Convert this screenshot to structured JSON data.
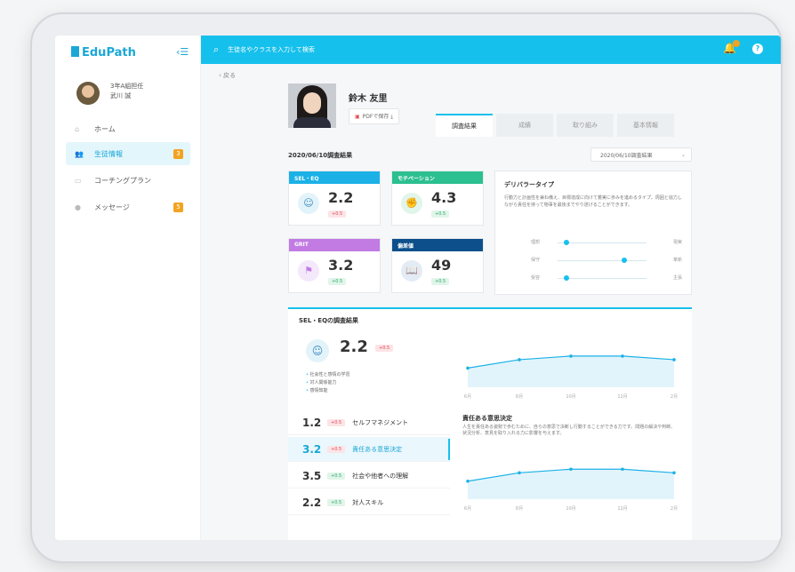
{
  "sidebar": {
    "logo": "EduPath",
    "collapse_icon": "menu-collapse-icon",
    "user": {
      "class": "3年A組担任",
      "name": "武川 誠"
    },
    "items": [
      {
        "label": "ホーム",
        "icon": "home-icon",
        "active": false,
        "badge": ""
      },
      {
        "label": "生徒情報",
        "icon": "users-icon",
        "active": true,
        "badge": "3"
      },
      {
        "label": "コーチングプラン",
        "icon": "plan-icon",
        "active": false,
        "badge": ""
      },
      {
        "label": "メッセージ",
        "icon": "message-icon",
        "active": false,
        "badge": "5"
      }
    ]
  },
  "header": {
    "search_placeholder": "生徒名やクラスを入力して検索",
    "notification_badge": "1",
    "help": "?"
  },
  "main": {
    "back": "‹ 戻る",
    "student_name": "鈴木 友里",
    "pdf_label": "PDFで保存 ⤓",
    "tabs": [
      "調査結果",
      "成績",
      "取り組み",
      "基本情報"
    ],
    "active_tab": 0,
    "result_title": "2020/06/10調査結果",
    "date_select": "2020/06/10調査結果",
    "metrics": [
      {
        "title": "SEL・EQ",
        "value": "2.2",
        "delta": "+0.5",
        "delta_type": "red",
        "color": "#1bb1e6",
        "icon": "sel-icon"
      },
      {
        "title": "モチベーション",
        "value": "4.3",
        "delta": "+0.5",
        "delta_type": "green",
        "color": "#2cbf8f",
        "icon": "motivation-icon"
      },
      {
        "title": "GRIT",
        "value": "3.2",
        "delta": "+0.5",
        "delta_type": "green",
        "color": "#c17be3",
        "icon": "flag-icon"
      },
      {
        "title": "偏差値",
        "value": "49",
        "delta": "+0.5",
        "delta_type": "green",
        "color": "#0d4f8b",
        "icon": "book-icon"
      }
    ],
    "type_card": {
      "title": "デリバラータイプ",
      "desc": "行動力と計画性を兼ね備え、目標達成に向けて着実に歩みを進めるタイプ。周囲と協力しながら責任を持って物事を最後までやり遂げることができます。",
      "sliders": [
        {
          "left": "理想",
          "right": "現実",
          "pos": 0.1
        },
        {
          "left": "保守",
          "right": "革新",
          "pos": 0.75
        },
        {
          "left": "受容",
          "right": "主張",
          "pos": 0.1
        }
      ]
    },
    "sel_panel": {
      "title": "SEL・EQの調査結果",
      "value": "2.2",
      "delta": "+0.5",
      "bullets": [
        "社会性と感情の学習",
        "対人関係能力",
        "感情知能"
      ],
      "rows": [
        {
          "value": "1.2",
          "delta": "+0.5",
          "delta_type": "red",
          "label": "セルフマネジメント",
          "active": false
        },
        {
          "value": "3.2",
          "delta": "+0.5",
          "delta_type": "red",
          "label": "責任ある意思決定",
          "active": true
        },
        {
          "value": "3.5",
          "delta": "+0.5",
          "delta_type": "green",
          "label": "社会や他者への理解",
          "active": false
        },
        {
          "value": "2.2",
          "delta": "+0.5",
          "delta_type": "green",
          "label": "対人スキル",
          "active": false
        }
      ],
      "detail_title": "責任ある意思決定",
      "detail_desc": "人生を責任ある姿勢で歩むために、自らの意思で決断し行動することができる力です。問題の解決や判断、状況分析、意見を取り入れる力に影響を与えます。"
    }
  },
  "chart_data": [
    {
      "type": "area",
      "title": "",
      "x": [
        "6月",
        "8月",
        "10月",
        "12月",
        "2月"
      ],
      "series": [
        {
          "values": [
            1.6,
            2.3,
            2.6,
            2.6,
            2.3
          ]
        }
      ],
      "ylim": [
        0,
        4
      ],
      "grid": false
    },
    {
      "type": "area",
      "title": "",
      "x": [
        "6月",
        "8月",
        "10月",
        "12月",
        "2月"
      ],
      "series": [
        {
          "values": [
            1.5,
            2.2,
            2.5,
            2.5,
            2.2
          ]
        }
      ],
      "ylim": [
        0,
        4
      ],
      "grid": false
    }
  ]
}
